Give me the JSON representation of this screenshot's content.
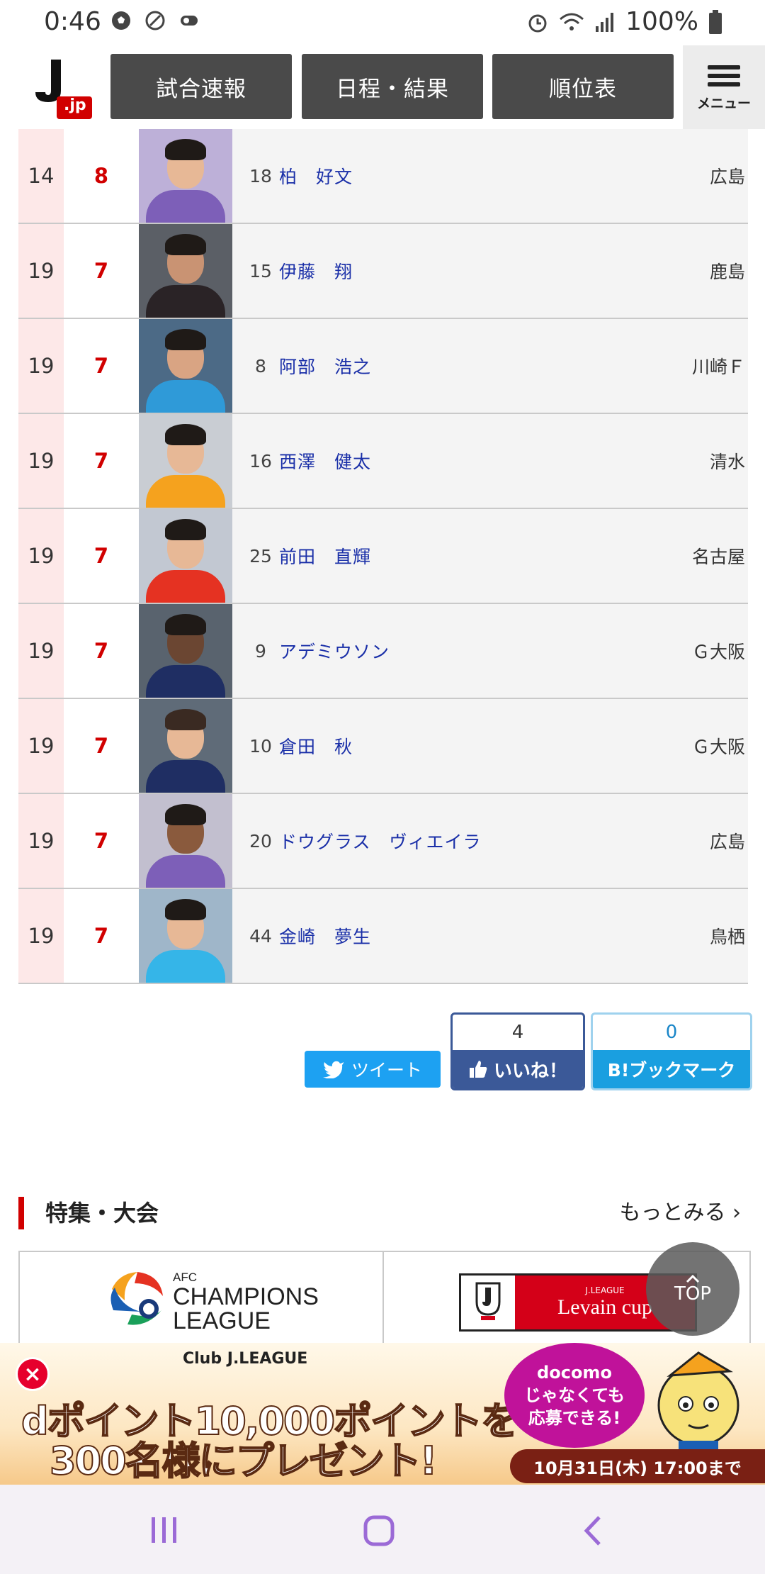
{
  "status_bar": {
    "time": "0:46",
    "battery": "100%"
  },
  "header": {
    "logo_text": ".jp",
    "nav": [
      "試合速報",
      "日程・結果",
      "順位表"
    ],
    "menu_label": "メニュー"
  },
  "rankings": [
    {
      "rank": "14",
      "goals": "8",
      "number": "18",
      "name": "柏　好文",
      "club": "広島"
    },
    {
      "rank": "19",
      "goals": "7",
      "number": "15",
      "name": "伊藤　翔",
      "club": "鹿島"
    },
    {
      "rank": "19",
      "goals": "7",
      "number": "8",
      "name": "阿部　浩之",
      "club": "川崎Ｆ"
    },
    {
      "rank": "19",
      "goals": "7",
      "number": "16",
      "name": "西澤　健太",
      "club": "清水"
    },
    {
      "rank": "19",
      "goals": "7",
      "number": "25",
      "name": "前田　直輝",
      "club": "名古屋"
    },
    {
      "rank": "19",
      "goals": "7",
      "number": "9",
      "name": "アデミウソン",
      "club": "Ｇ大阪"
    },
    {
      "rank": "19",
      "goals": "7",
      "number": "10",
      "name": "倉田　秋",
      "club": "Ｇ大阪"
    },
    {
      "rank": "19",
      "goals": "7",
      "number": "20",
      "name": "ドウグラス　ヴィエイラ",
      "club": "広島"
    },
    {
      "rank": "19",
      "goals": "7",
      "number": "44",
      "name": "金崎　夢生",
      "club": "鳥栖"
    }
  ],
  "social": {
    "tweet": "ツイート",
    "like_count": "4",
    "like": "いいね！",
    "bookmark_count": "0",
    "bookmark": "B!ブックマーク"
  },
  "features": {
    "title": "特集・大会",
    "more": "もっとみる ›",
    "acl_line1": "AFC",
    "acl_line2": "CHAMPIONS",
    "acl_line3": "LEAGUE",
    "levain_small": "J.LEAGUE",
    "levain": "Levain cup",
    "top": "TOP"
  },
  "ad": {
    "brand": "Club J.LEAGUE",
    "line1": "dポイント10,000ポイントを",
    "line2": "300名様にプレゼント!",
    "bubble1": "docomo",
    "bubble2": "じゃなくても",
    "bubble3": "応募できる!",
    "deadline": "10月31日(木) 17:00まで"
  },
  "colors": {
    "accent": "#d10000",
    "link": "#1a2fa8",
    "nav_bg": "#4a4a4a"
  }
}
